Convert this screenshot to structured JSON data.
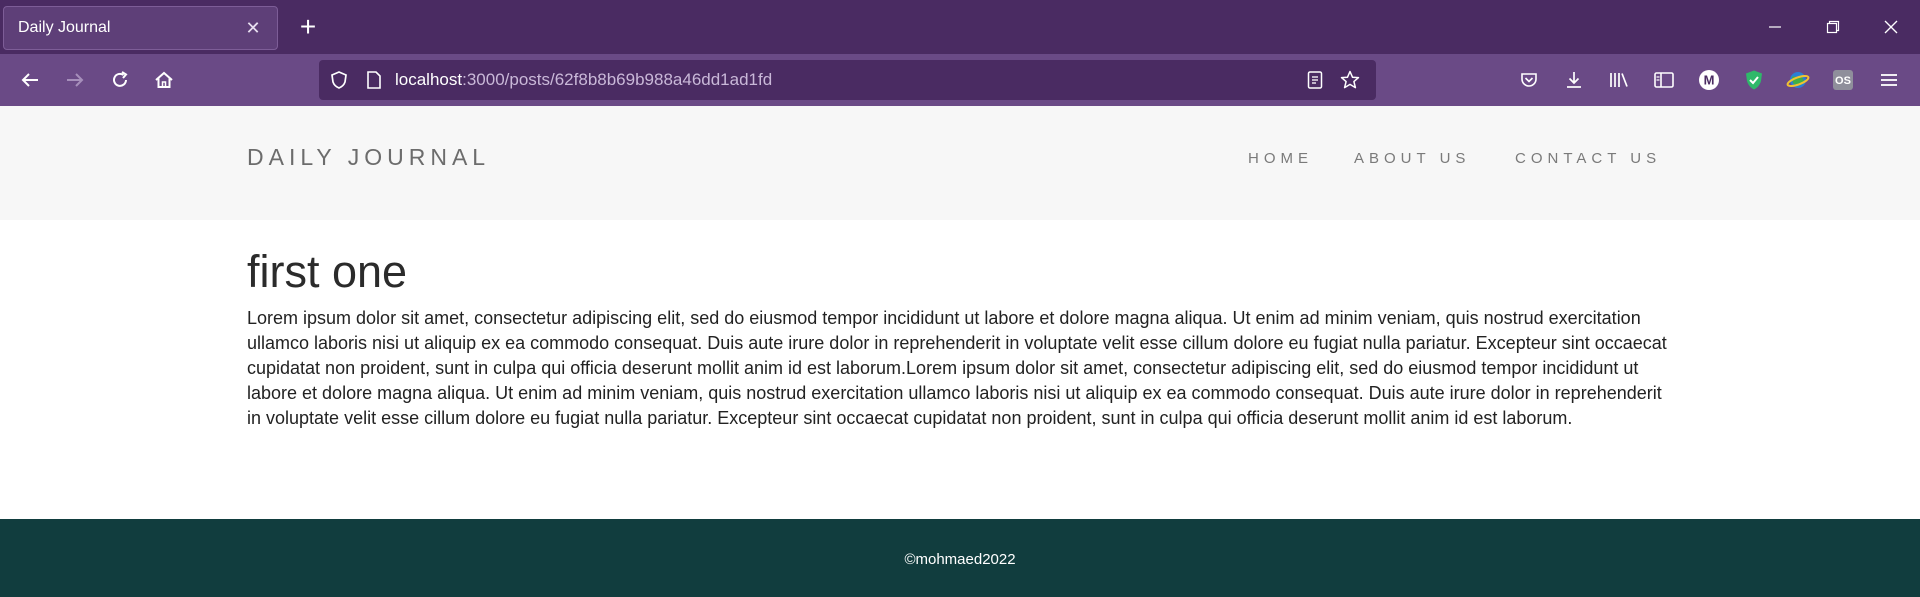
{
  "browser": {
    "tab": {
      "title": "Daily Journal",
      "close_glyph": "✕"
    },
    "new_tab_glyph": "+",
    "url": {
      "host": "localhost",
      "path": ":3000/posts/62f8b8b69b988a46dd1ad1fd"
    },
    "colors": {
      "tabbar": "#4a2b62",
      "toolbar": "#6a4a86"
    }
  },
  "site": {
    "brand": "DAILY JOURNAL",
    "nav": [
      {
        "label": "HOME"
      },
      {
        "label": "ABOUT US"
      },
      {
        "label": "CONTACT US"
      }
    ]
  },
  "post": {
    "title": "first one",
    "body": "Lorem ipsum dolor sit amet, consectetur adipiscing elit, sed do eiusmod tempor incididunt ut labore et dolore magna aliqua. Ut enim ad minim veniam, quis nostrud exercitation ullamco laboris nisi ut aliquip ex ea commodo consequat. Duis aute irure dolor in reprehenderit in voluptate velit esse cillum dolore eu fugiat nulla pariatur. Excepteur sint occaecat cupidatat non proident, sunt in culpa qui officia deserunt mollit anim id est laborum.Lorem ipsum dolor sit amet, consectetur adipiscing elit, sed do eiusmod tempor incididunt ut labore et dolore magna aliqua. Ut enim ad minim veniam, quis nostrud exercitation ullamco laboris nisi ut aliquip ex ea commodo consequat. Duis aute irure dolor in reprehenderit in voluptate velit esse cillum dolore eu fugiat nulla pariatur. Excepteur sint occaecat cupidatat non proident, sunt in culpa qui officia deserunt mollit anim id est laborum."
  },
  "footer": {
    "text": "©mohmaed2022",
    "color": "#113d3e"
  }
}
